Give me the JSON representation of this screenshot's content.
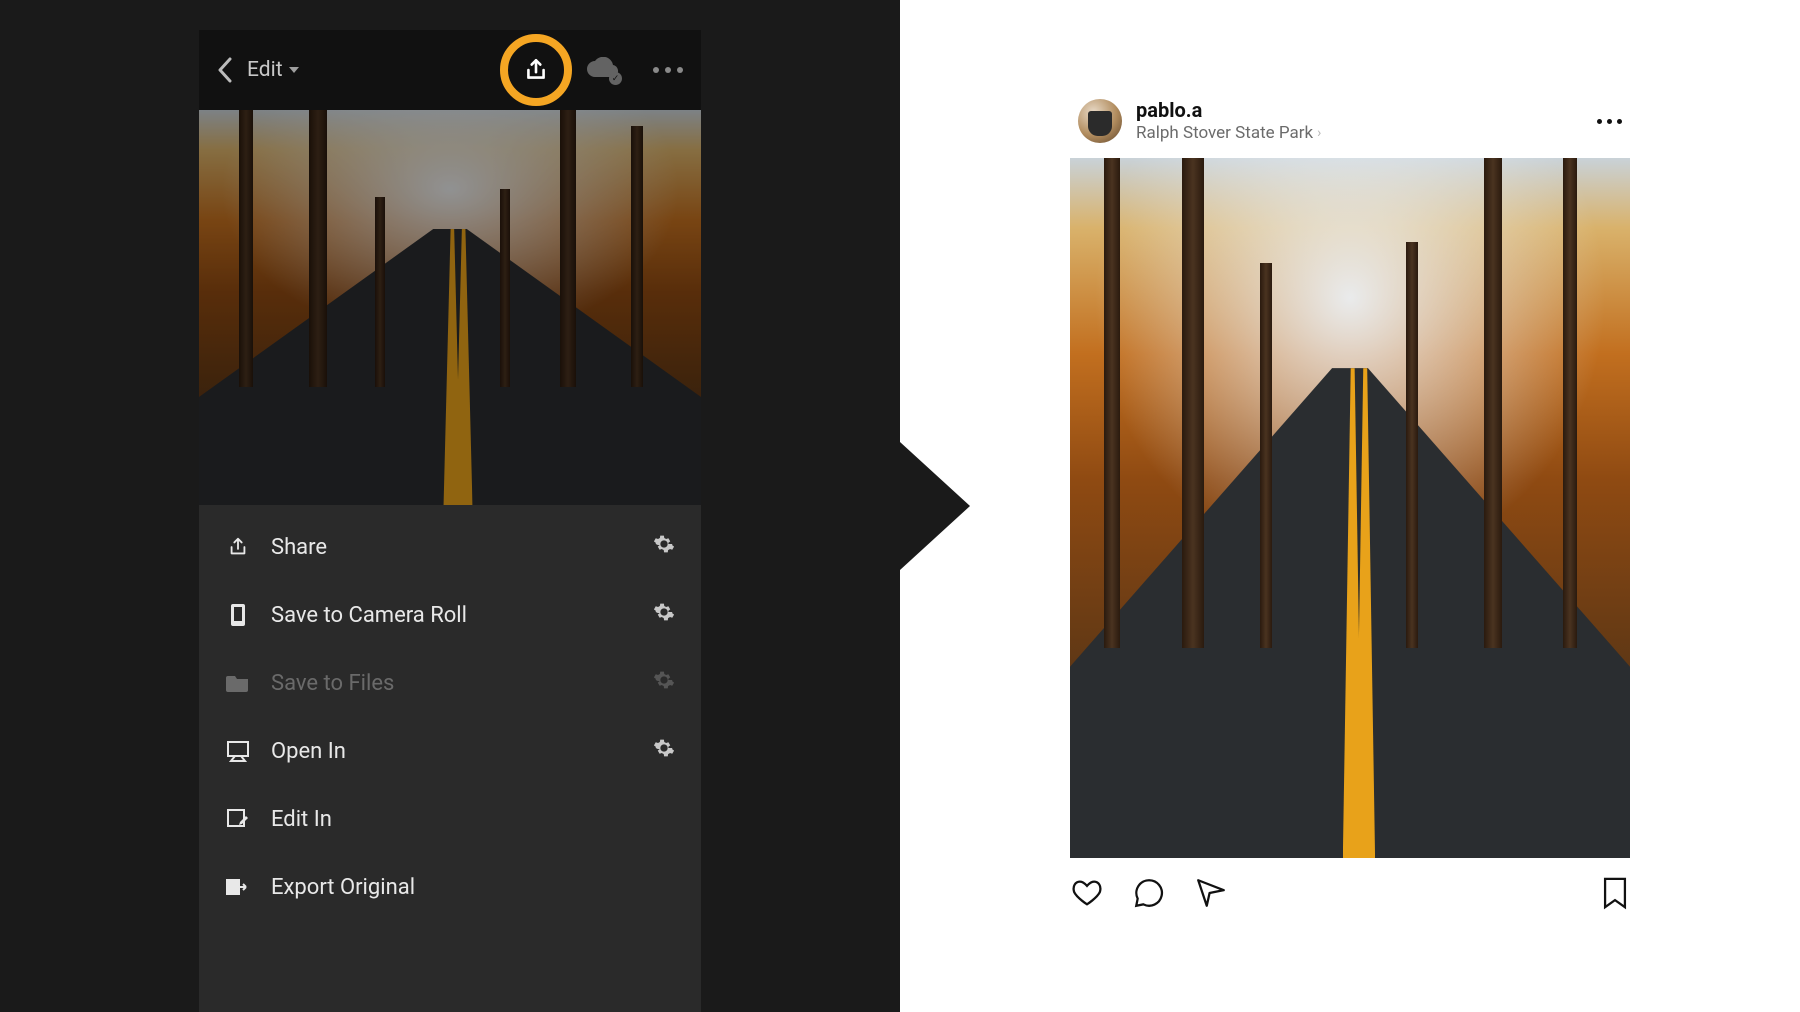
{
  "lightroom": {
    "mode_label": "Edit",
    "highlight_color": "#f5a623",
    "share_icon": "share-icon",
    "cloud_icon": "cloud-sync-icon",
    "more_icon": "more-icon",
    "menu": [
      {
        "icon": "share-icon",
        "label": "Share",
        "enabled": true,
        "has_gear": true
      },
      {
        "icon": "device-icon",
        "label": "Save to Camera Roll",
        "enabled": true,
        "has_gear": true
      },
      {
        "icon": "folder-icon",
        "label": "Save to Files",
        "enabled": false,
        "has_gear": true
      },
      {
        "icon": "open-in-icon",
        "label": "Open In",
        "enabled": true,
        "has_gear": true
      },
      {
        "icon": "edit-in-icon",
        "label": "Edit In",
        "enabled": true,
        "has_gear": false
      },
      {
        "icon": "export-icon",
        "label": "Export Original",
        "enabled": true,
        "has_gear": false
      }
    ]
  },
  "instagram": {
    "username": "pablo.a",
    "location": "Ralph Stover State Park",
    "actions": {
      "like": "heart-icon",
      "comment": "comment-icon",
      "send": "send-icon",
      "save": "bookmark-icon",
      "more": "more-icon"
    }
  }
}
